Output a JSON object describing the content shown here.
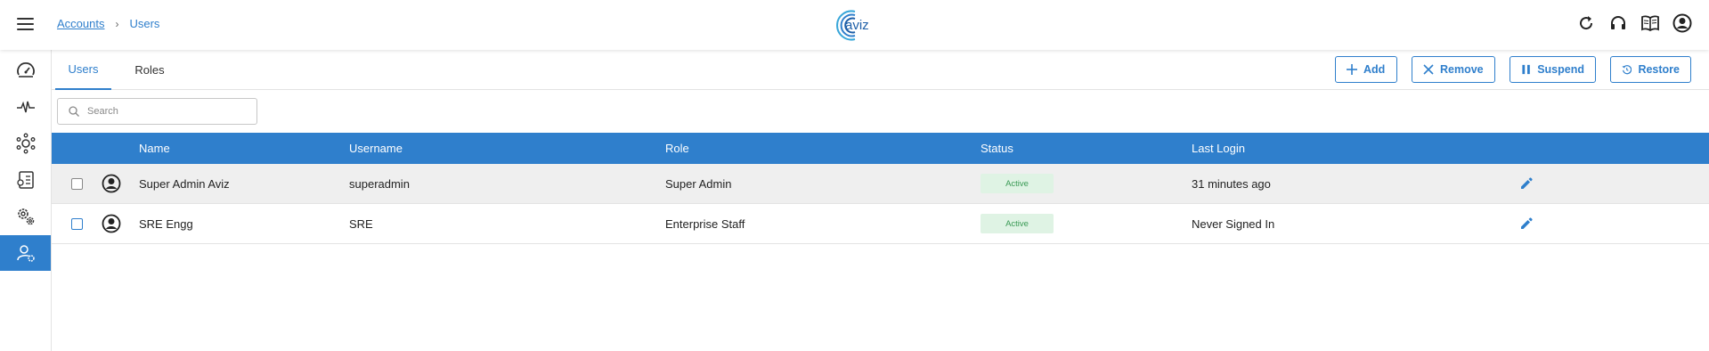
{
  "header": {
    "breadcrumb": {
      "parent": "Accounts",
      "separator": "›",
      "current": "Users"
    },
    "logo_text": "aviz",
    "icons": [
      "refresh-icon",
      "headset-icon",
      "book-icon",
      "account-icon"
    ]
  },
  "sidebar": {
    "items": [
      {
        "icon": "dashboard-gauge-icon"
      },
      {
        "icon": "pulse-icon"
      },
      {
        "icon": "network-gear-icon"
      },
      {
        "icon": "document-settings-icon"
      },
      {
        "icon": "settings-gears-icon"
      },
      {
        "icon": "user-settings-icon",
        "active": true
      }
    ]
  },
  "tabs": [
    {
      "label": "Users",
      "active": true
    },
    {
      "label": "Roles",
      "active": false
    }
  ],
  "actions": {
    "add": "Add",
    "remove": "Remove",
    "suspend": "Suspend",
    "restore": "Restore"
  },
  "search": {
    "placeholder": "Search",
    "value": ""
  },
  "table": {
    "columns": {
      "name": "Name",
      "username": "Username",
      "role": "Role",
      "status": "Status",
      "last_login": "Last Login"
    },
    "rows": [
      {
        "name": "Super Admin Aviz",
        "username": "superadmin",
        "role": "Super Admin",
        "status": "Active",
        "last_login": "31 minutes ago",
        "selected": true
      },
      {
        "name": "SRE Engg",
        "username": "SRE",
        "role": "Enterprise Staff",
        "status": "Active",
        "last_login": "Never Signed In",
        "selected": false
      }
    ]
  },
  "colors": {
    "accent": "#2f7fcc",
    "active_badge_bg": "#dff3e4",
    "active_badge_text": "#3a9a55"
  }
}
